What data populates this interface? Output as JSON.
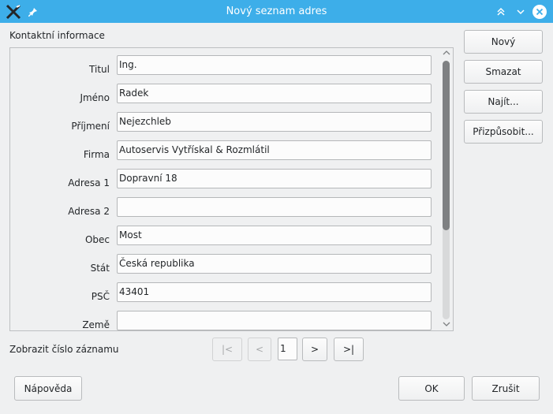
{
  "window": {
    "title": "Nový seznam adres"
  },
  "group": {
    "title": "Kontaktní informace"
  },
  "fields": [
    {
      "label": "Titul",
      "value": "Ing."
    },
    {
      "label": "Jméno",
      "value": "Radek"
    },
    {
      "label": "Příjmení",
      "value": "Nejezchleb"
    },
    {
      "label": "Firma",
      "value": "Autoservis Vytřískal & Rozmlátil"
    },
    {
      "label": "Adresa 1",
      "value": "Dopravní 18"
    },
    {
      "label": "Adresa 2",
      "value": ""
    },
    {
      "label": "Obec",
      "value": "Most"
    },
    {
      "label": "Stát",
      "value": "Česká republika"
    },
    {
      "label": "PSČ",
      "value": "43401"
    },
    {
      "label": "Země",
      "value": ""
    }
  ],
  "side_buttons": {
    "new": "Nový",
    "delete": "Smazat",
    "find": "Najít...",
    "customize": "Přizpůsobit..."
  },
  "navigation": {
    "label": "Zobrazit číslo záznamu",
    "first": "|<",
    "prev": "<",
    "record": "1",
    "next": ">",
    "last": ">|"
  },
  "footer": {
    "help": "Nápověda",
    "ok": "OK",
    "cancel": "Zrušit"
  },
  "colors": {
    "titlebar": "#3daee9",
    "window_bg": "#eff0f1",
    "field_bg": "#fcfcfc"
  }
}
